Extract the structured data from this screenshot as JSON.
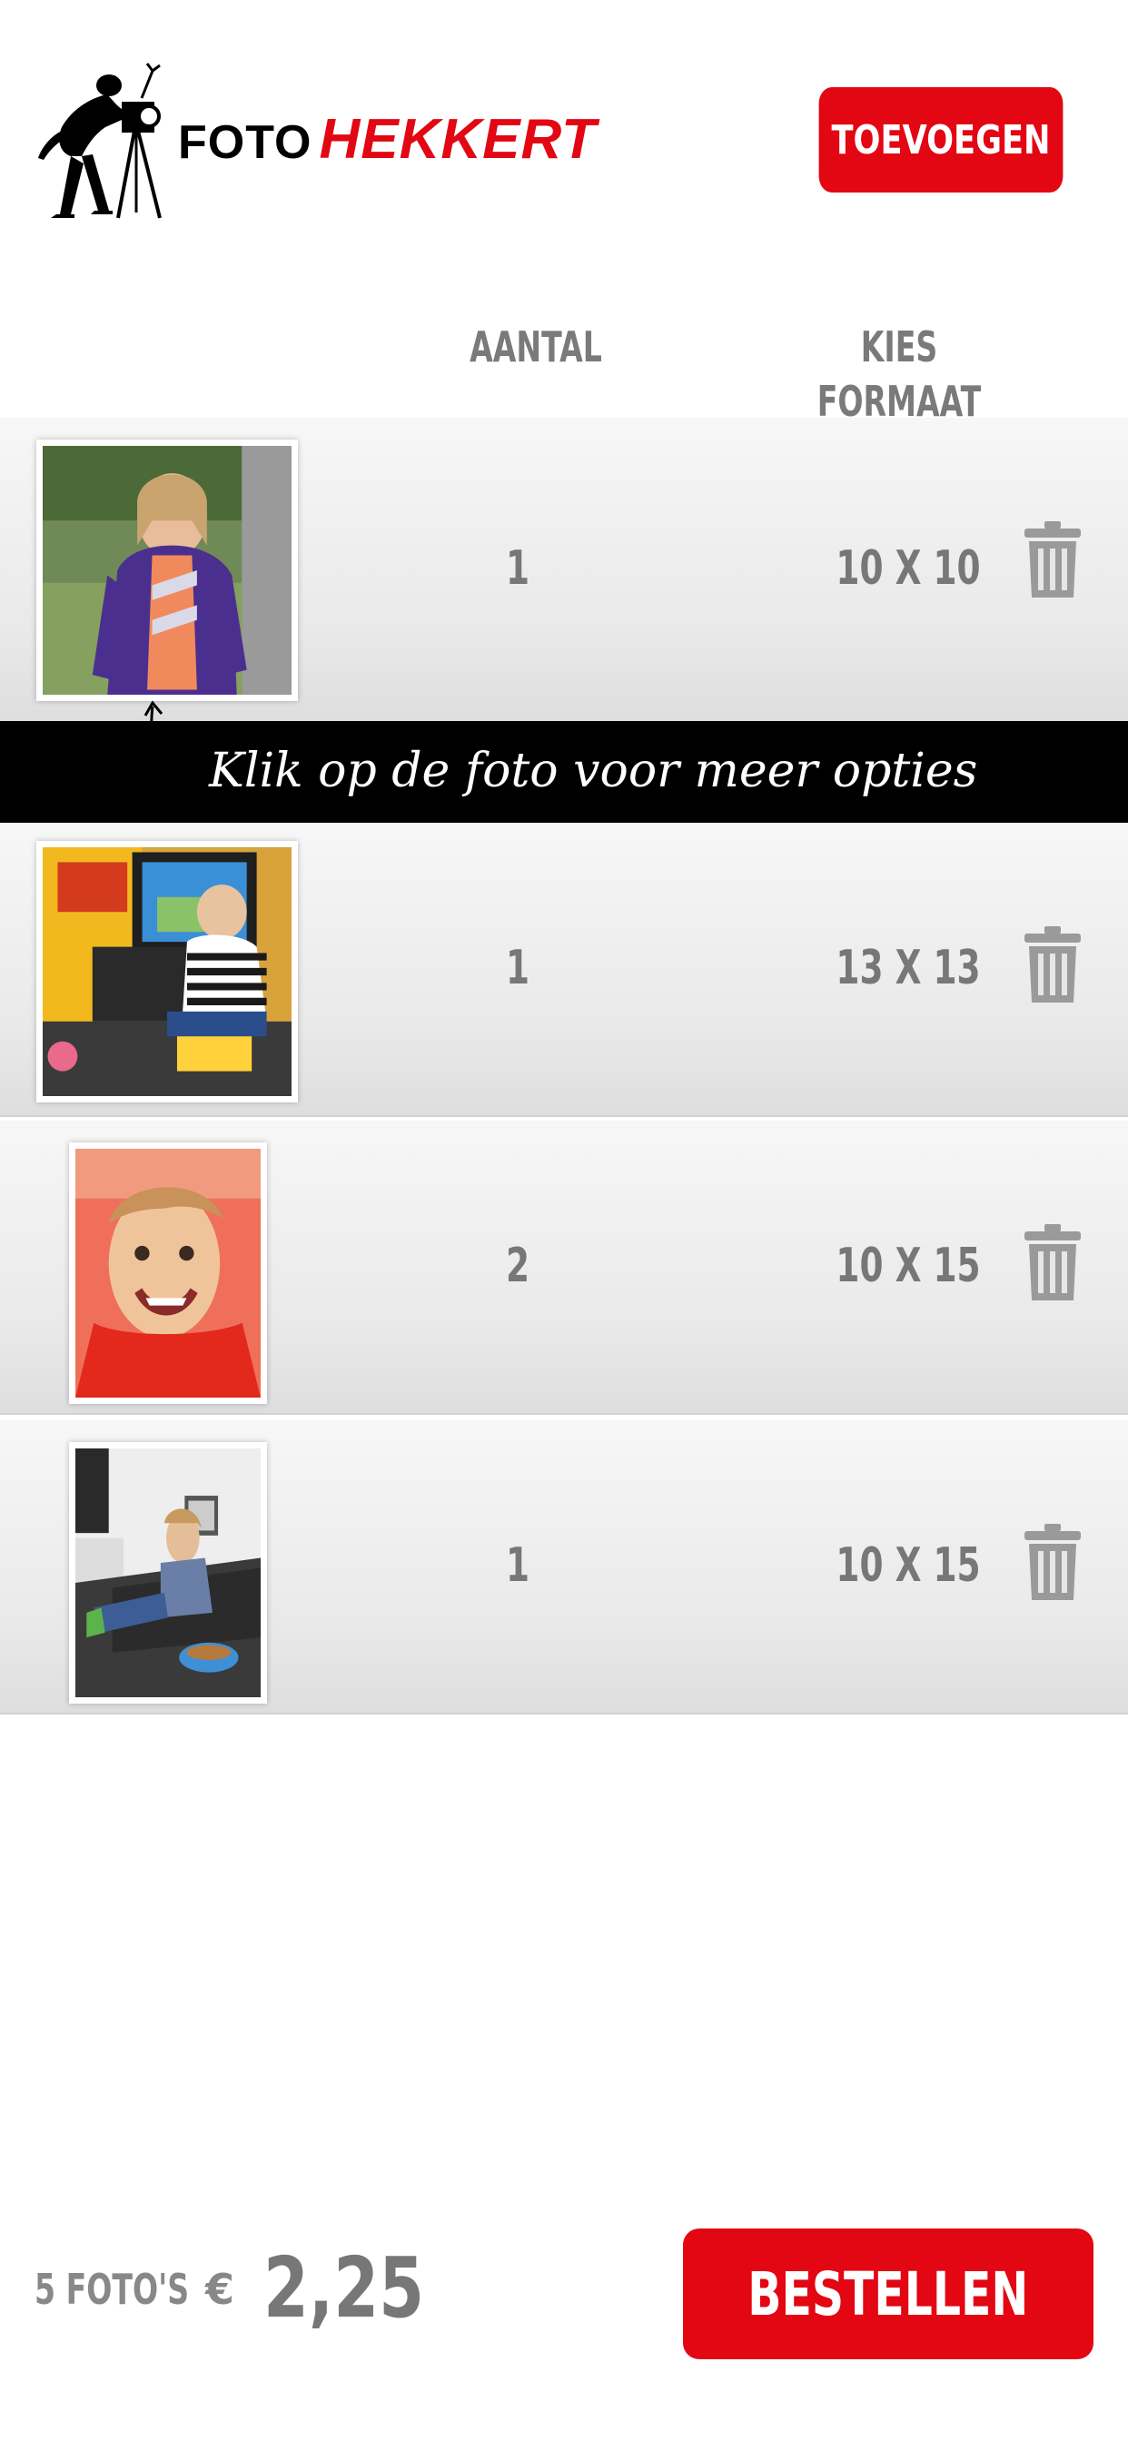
{
  "brand": {
    "name_part1": "FOTO",
    "name_part2": "HEKKERT",
    "accent_color": "#e30613"
  },
  "header": {
    "add_button_label": "TOEVOEGEN"
  },
  "columns": {
    "quantity": "AANTAL",
    "format": "KIES FORMAAT"
  },
  "hint": "Klik op de foto voor meer opties",
  "items": [
    {
      "quantity": "1",
      "format": "10 X 10",
      "photo": "girl-purple-jacket-photo"
    },
    {
      "quantity": "1",
      "format": "13 X 13",
      "photo": "boy-arcade-game-photo"
    },
    {
      "quantity": "2",
      "format": "10 X 15",
      "photo": "child-red-shirt-photo"
    },
    {
      "quantity": "1",
      "format": "10 X 15",
      "photo": "boy-sofa-tablet-photo"
    }
  ],
  "footer": {
    "count_label": "5 FOTO'S",
    "currency": "€",
    "total": "2,25",
    "order_button_label": "BESTELLEN"
  },
  "icons": {
    "trash": "trash-icon",
    "logo": "photographer-logo-icon",
    "hint_arrow": "curved-arrow-icon"
  }
}
